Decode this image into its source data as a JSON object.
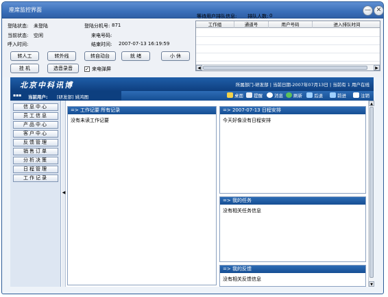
{
  "window": {
    "title": "座席监控界面",
    "min": "—",
    "close": "✕"
  },
  "status": {
    "login_status_label": "登陆状态:",
    "login_status_value": "未登陆",
    "ext_label": "登陆分机号:",
    "ext_value": "871",
    "current_label": "当前状态:",
    "current_value": "空闲",
    "caller_label": "来电号码:",
    "caller_value": "",
    "call_time_label": "呼入时间:",
    "call_time_value": "",
    "end_time_label": "结束时间:",
    "end_time_value": "2007-07-13 16:19:59"
  },
  "buttons": {
    "transfer_agent": "转人工",
    "transfer_external": "转外线",
    "transfer_auto": "转自动台",
    "ready": "就 绪",
    "rest": "小 休",
    "hangup": "挂 机",
    "select_record": "选音录音",
    "incoming_popup": "来电弹屏",
    "incoming_popup_checked": true
  },
  "queue": {
    "title": "等待用户排队信息:",
    "count_label": "排队人数:",
    "count_value": "0",
    "columns": [
      "工作组",
      "通道号",
      "用户号码",
      "进入排队时间"
    ]
  },
  "banner": {
    "company": "北京中科讯博",
    "dept": "所属部门-研发部",
    "date": "当前日期-2007年07月13日",
    "online": "当前有 1 用户在线"
  },
  "user": {
    "label": "当前用户:",
    "value": "[研发部] 姚鸿图"
  },
  "toolbar": {
    "desktop": "桌面",
    "remind": "提醒",
    "message": "消息",
    "refresh": "刷新",
    "back": "后退",
    "forward": "前进",
    "logout": "注销"
  },
  "sidebar": {
    "items": [
      "信息中心",
      "员工信息",
      "产品中心",
      "客户中心",
      "反馈管理",
      "销售订单",
      "分析决策",
      "日程管理",
      "工作记录"
    ]
  },
  "panels": {
    "worklog": {
      "title": "=> 工作记要 所有记录",
      "content": "没有未读工作记要"
    },
    "schedule": {
      "title": "=> 2007-07-13 日程安排",
      "content": "今天好像没有日程安排"
    },
    "tasks": {
      "title": "=> 我的任务",
      "content": "没有相关任务信息"
    },
    "feedback": {
      "title": "=> 我的反馈",
      "content": "没有相关反馈信息"
    }
  },
  "colors": {
    "title_bar": "#3a6fb9",
    "banner": "#0e3f80",
    "panel_header": "#1f5ea8",
    "sidebar": "#dde6f2"
  }
}
